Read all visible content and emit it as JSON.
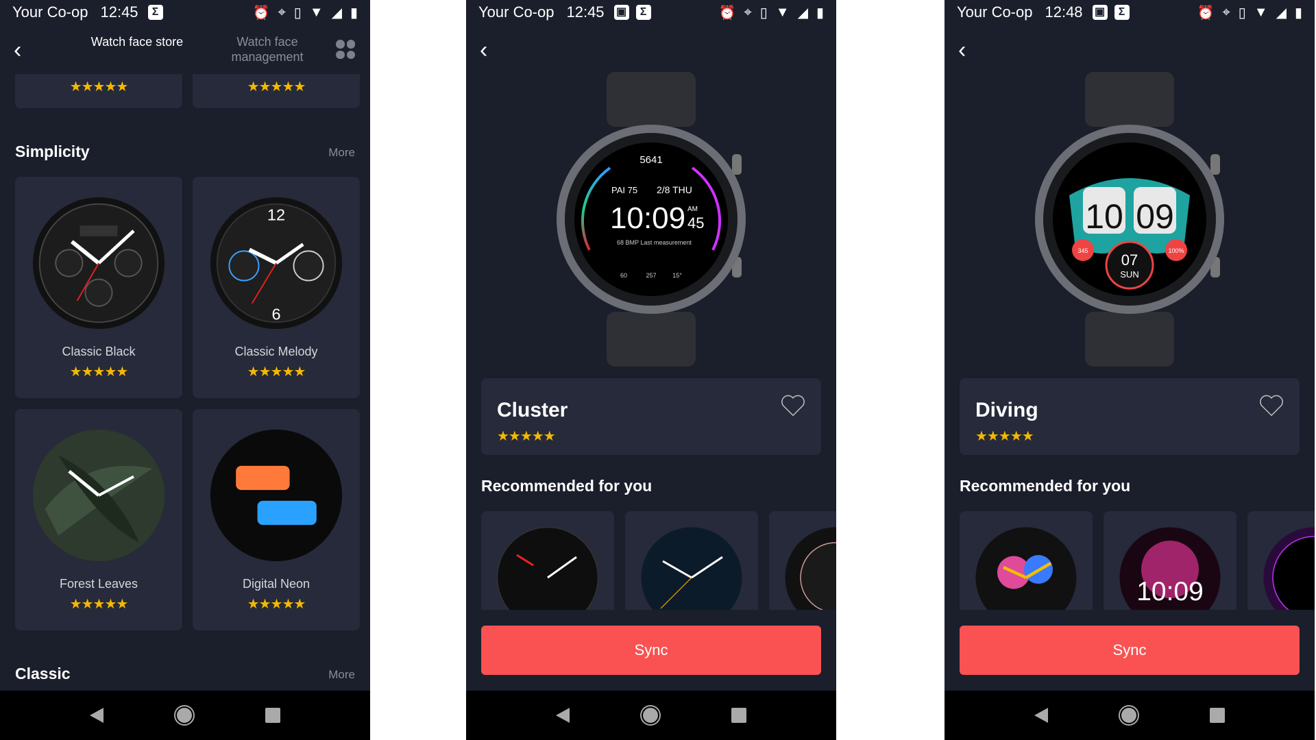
{
  "status_bars": [
    {
      "carrier": "Your Co-op",
      "time": "12:45"
    },
    {
      "carrier": "Your Co-op",
      "time": "12:45"
    },
    {
      "carrier": "Your Co-op",
      "time": "12:48"
    }
  ],
  "store": {
    "tabs": [
      {
        "label": "Watch face store",
        "active": true
      },
      {
        "label": "Watch face management",
        "active": false
      }
    ],
    "sections": [
      {
        "title": "Simplicity",
        "more": "More"
      },
      {
        "title": "Classic",
        "more": "More"
      }
    ],
    "faces": [
      {
        "name": "Classic Black",
        "rating": 5
      },
      {
        "name": "Classic Melody",
        "rating": 5
      },
      {
        "name": "Forest Leaves",
        "rating": 5
      },
      {
        "name": "Digital Neon",
        "rating": 5
      }
    ],
    "top_ratings": [
      5,
      5
    ]
  },
  "stars": "★★★★★",
  "detail_cluster": {
    "title": "Cluster",
    "rating": 5,
    "watch": {
      "steps": "5641",
      "pai": "PAI 75",
      "date": "2/8 THU",
      "time": "10:09",
      "ampm": "AM",
      "seconds": "45",
      "hr": "68 BMP  Last measurement",
      "stats": [
        "60",
        "257",
        "15°"
      ]
    },
    "recommended_title": "Recommended for you",
    "sync_label": "Sync"
  },
  "detail_diving": {
    "title": "Diving",
    "rating": 5,
    "watch": {
      "hour": "10",
      "minute": "09",
      "day": "07",
      "weekday": "SUN",
      "left": "345",
      "right": "100%"
    },
    "recommended_title": "Recommended for you",
    "rec_time": "10:09",
    "sync_label": "Sync"
  },
  "colors": {
    "background": "#1b1e2b",
    "card": "#262a3a",
    "accent": "#fa5252",
    "star": "#f6b900"
  }
}
